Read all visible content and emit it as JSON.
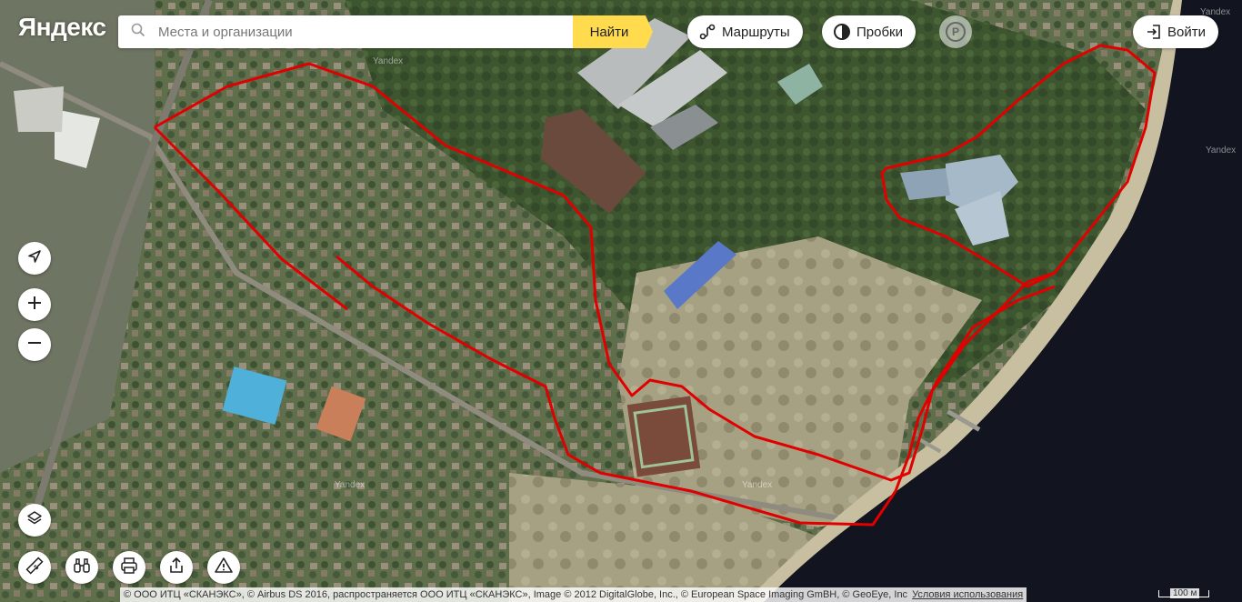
{
  "logo": "Яндекс",
  "search": {
    "placeholder": "Места и организации",
    "button_label": "Найти"
  },
  "toolbar": {
    "routes_label": "Маршруты",
    "traffic_label": "Пробки",
    "parking_label": "P",
    "login_label": "Войти"
  },
  "map": {
    "layer": "satellite",
    "overlay_color": "#e00000",
    "watermark": "Yandex"
  },
  "scale": {
    "label": "100 м"
  },
  "copyright": {
    "text": "© ООО ИТЦ «СКАНЭКС», © Airbus DS 2016, распространяется ООО ИТЦ «СКАНЭКС», Image © 2012 DigitalGlobe, Inc., © European Space Imaging GmBH, © GeoEye, Inc",
    "terms_label": "Условия использования"
  },
  "icons": {
    "locate": "location-arrow-icon",
    "zoom_in": "plus-icon",
    "zoom_out": "minus-icon",
    "layers": "layers-icon",
    "ruler": "ruler-icon",
    "panorama": "binoculars-icon",
    "print": "printer-icon",
    "share": "share-icon",
    "report": "warning-icon"
  }
}
